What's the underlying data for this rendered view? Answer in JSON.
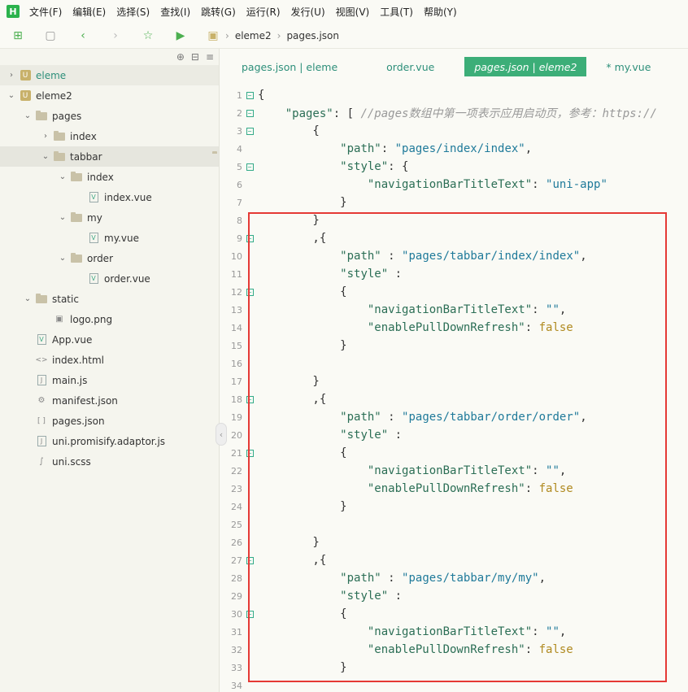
{
  "menu": [
    "文件(F)",
    "编辑(E)",
    "选择(S)",
    "查找(I)",
    "跳转(G)",
    "运行(R)",
    "发行(U)",
    "视图(V)",
    "工具(T)",
    "帮助(Y)"
  ],
  "toolbar": {
    "breadcrumb": [
      "eleme2",
      "pages.json"
    ],
    "icons": [
      "new-file-icon",
      "save-icon",
      "back-icon",
      "forward-icon",
      "star-icon",
      "run-icon",
      "project-icon"
    ]
  },
  "tree": [
    {
      "label": "eleme",
      "level": 0,
      "arrow": "›",
      "type": "project",
      "state": "project-active"
    },
    {
      "label": "eleme2",
      "level": 0,
      "arrow": "⌄",
      "type": "project"
    },
    {
      "label": "pages",
      "level": 1,
      "arrow": "⌄",
      "type": "folder"
    },
    {
      "label": "index",
      "level": 2,
      "arrow": "›",
      "type": "folder"
    },
    {
      "label": "tabbar",
      "level": 2,
      "arrow": "⌄",
      "type": "folder",
      "state": "selected"
    },
    {
      "label": "index",
      "level": 3,
      "arrow": "⌄",
      "type": "folder"
    },
    {
      "label": "index.vue",
      "level": 4,
      "arrow": "",
      "type": "vue"
    },
    {
      "label": "my",
      "level": 3,
      "arrow": "⌄",
      "type": "folder"
    },
    {
      "label": "my.vue",
      "level": 4,
      "arrow": "",
      "type": "vue"
    },
    {
      "label": "order",
      "level": 3,
      "arrow": "⌄",
      "type": "folder"
    },
    {
      "label": "order.vue",
      "level": 4,
      "arrow": "",
      "type": "vue"
    },
    {
      "label": "static",
      "level": 1,
      "arrow": "⌄",
      "type": "folder"
    },
    {
      "label": "logo.png",
      "level": 2,
      "arrow": "",
      "type": "image"
    },
    {
      "label": "App.vue",
      "level": 1,
      "arrow": "",
      "type": "vue"
    },
    {
      "label": "index.html",
      "level": 1,
      "arrow": "",
      "type": "html"
    },
    {
      "label": "main.js",
      "level": 1,
      "arrow": "",
      "type": "js"
    },
    {
      "label": "manifest.json",
      "level": 1,
      "arrow": "",
      "type": "manifest"
    },
    {
      "label": "pages.json",
      "level": 1,
      "arrow": "",
      "type": "json"
    },
    {
      "label": "uni.promisify.adaptor.js",
      "level": 1,
      "arrow": "",
      "type": "js"
    },
    {
      "label": "uni.scss",
      "level": 1,
      "arrow": "",
      "type": "scss"
    }
  ],
  "tabs": [
    {
      "label": "pages.json | eleme",
      "active": false
    },
    {
      "label": "order.vue",
      "active": false
    },
    {
      "label": "pages.json | eleme2",
      "active": true
    },
    {
      "label": "* my.vue",
      "active": false
    }
  ],
  "code": [
    {
      "n": "1",
      "fold": true,
      "text": "{"
    },
    {
      "n": "2",
      "fold": true,
      "text": "    \"pages\": [ //pages数组中第一项表示应用启动页，参考：https://"
    },
    {
      "n": "3",
      "fold": true,
      "text": "        {"
    },
    {
      "n": "4",
      "fold": false,
      "text": "            \"path\": \"pages/index/index\","
    },
    {
      "n": "5",
      "fold": true,
      "text": "            \"style\": {"
    },
    {
      "n": "6",
      "fold": false,
      "text": "                \"navigationBarTitleText\": \"uni-app\""
    },
    {
      "n": "7",
      "fold": false,
      "text": "            }"
    },
    {
      "n": "8",
      "fold": false,
      "text": "        }"
    },
    {
      "n": "9",
      "fold": true,
      "text": "        ,{"
    },
    {
      "n": "10",
      "fold": false,
      "text": "            \"path\" : \"pages/tabbar/index/index\","
    },
    {
      "n": "11",
      "fold": false,
      "text": "            \"style\" :"
    },
    {
      "n": "12",
      "fold": true,
      "text": "            {"
    },
    {
      "n": "13",
      "fold": false,
      "text": "                \"navigationBarTitleText\": \"\","
    },
    {
      "n": "14",
      "fold": false,
      "text": "                \"enablePullDownRefresh\": false"
    },
    {
      "n": "15",
      "fold": false,
      "text": "            }"
    },
    {
      "n": "16",
      "fold": false,
      "text": ""
    },
    {
      "n": "17",
      "fold": false,
      "text": "        }"
    },
    {
      "n": "18",
      "fold": true,
      "text": "        ,{"
    },
    {
      "n": "19",
      "fold": false,
      "text": "            \"path\" : \"pages/tabbar/order/order\","
    },
    {
      "n": "20",
      "fold": false,
      "text": "            \"style\" :"
    },
    {
      "n": "21",
      "fold": true,
      "text": "            {"
    },
    {
      "n": "22",
      "fold": false,
      "text": "                \"navigationBarTitleText\": \"\","
    },
    {
      "n": "23",
      "fold": false,
      "text": "                \"enablePullDownRefresh\": false"
    },
    {
      "n": "24",
      "fold": false,
      "text": "            }"
    },
    {
      "n": "25",
      "fold": false,
      "text": ""
    },
    {
      "n": "26",
      "fold": false,
      "text": "        }"
    },
    {
      "n": "27",
      "fold": true,
      "text": "        ,{"
    },
    {
      "n": "28",
      "fold": false,
      "text": "            \"path\" : \"pages/tabbar/my/my\","
    },
    {
      "n": "29",
      "fold": false,
      "text": "            \"style\" :"
    },
    {
      "n": "30",
      "fold": true,
      "text": "            {"
    },
    {
      "n": "31",
      "fold": false,
      "text": "                \"navigationBarTitleText\": \"\","
    },
    {
      "n": "32",
      "fold": false,
      "text": "                \"enablePullDownRefresh\": false"
    },
    {
      "n": "33",
      "fold": false,
      "text": "            }"
    },
    {
      "n": "34",
      "fold": false,
      "text": ""
    }
  ],
  "colors": {
    "accent": "#3cae78",
    "highlight_box": "#e53935",
    "key": "#2b6e55",
    "string": "#1f7a9a",
    "boolean": "#b08a20"
  }
}
